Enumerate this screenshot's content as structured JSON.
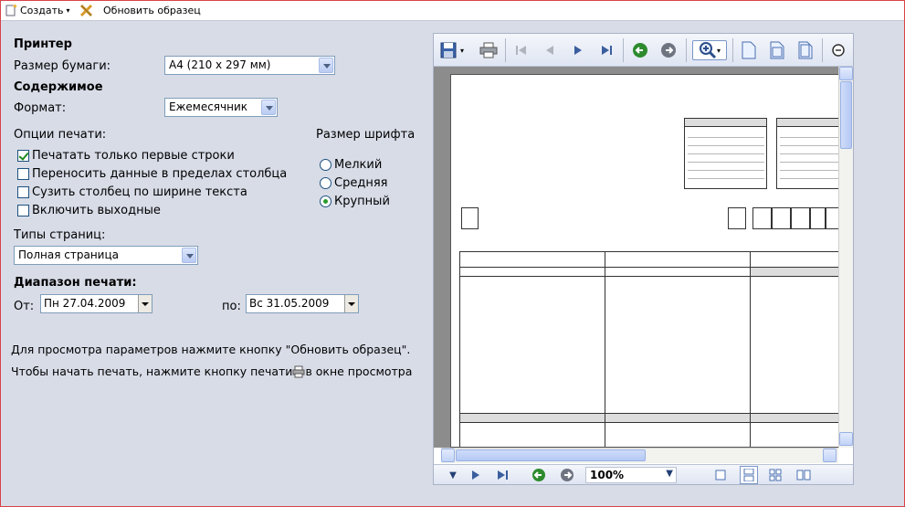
{
  "toolbar": {
    "create_label": "Создать",
    "refresh_label": "Обновить образец"
  },
  "printer": {
    "title": "Принтер",
    "paper_size_label": "Размер бумаги:",
    "paper_size_value": "А4 (210 x 297 мм)"
  },
  "content": {
    "title": "Содержимое",
    "format_label": "Формат:",
    "format_value": "Ежемесячник"
  },
  "print_options": {
    "title": "Опции печати:",
    "items": [
      {
        "label": "Печатать только первые строки",
        "checked": true
      },
      {
        "label": "Переносить данные в пределах столбца",
        "checked": false
      },
      {
        "label": "Сузить столбец по ширине текста",
        "checked": false
      },
      {
        "label": "Включить выходные",
        "checked": false
      }
    ]
  },
  "font_size": {
    "title": "Размер шрифта",
    "options": [
      {
        "label": "Мелкий",
        "selected": false
      },
      {
        "label": "Средняя",
        "selected": false
      },
      {
        "label": "Крупный",
        "selected": true
      }
    ]
  },
  "page_types": {
    "label": "Типы страниц:",
    "value": "Полная страница"
  },
  "print_range": {
    "title": "Диапазон печати:",
    "from_label": "От:",
    "from_value": "Пн 27.04.2009",
    "to_label": "по:",
    "to_value": "Вс 31.05.2009"
  },
  "hints": {
    "line1": "Для просмотра параметров нажмите кнопку \"Обновить образец\".",
    "line2_a": "Чтобы начать печать, нажмите кнопку печати",
    "line2_b": "в окне просмотра"
  },
  "preview": {
    "zoom": "100%"
  },
  "colors": {
    "accent_green": "#2e8b2e",
    "border_red": "#d9434a",
    "panel_bg": "#d8dce7"
  }
}
